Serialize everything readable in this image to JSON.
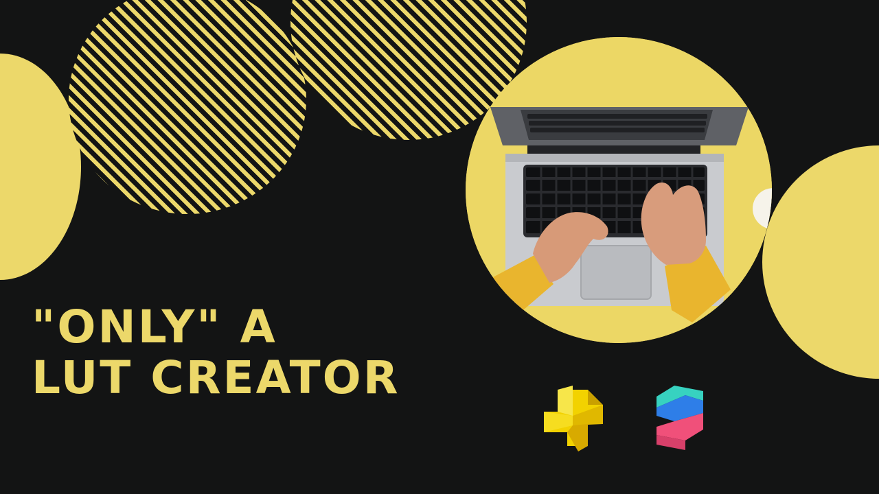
{
  "headline": {
    "line1": "\"ONLY\" A",
    "line2": "LUT CREATOR"
  },
  "colors": {
    "background": "#131414",
    "accent_yellow": "#ecd86a"
  },
  "icons": {
    "logo_left": "spark-ar-logo",
    "logo_right": "spline-s-logo"
  }
}
